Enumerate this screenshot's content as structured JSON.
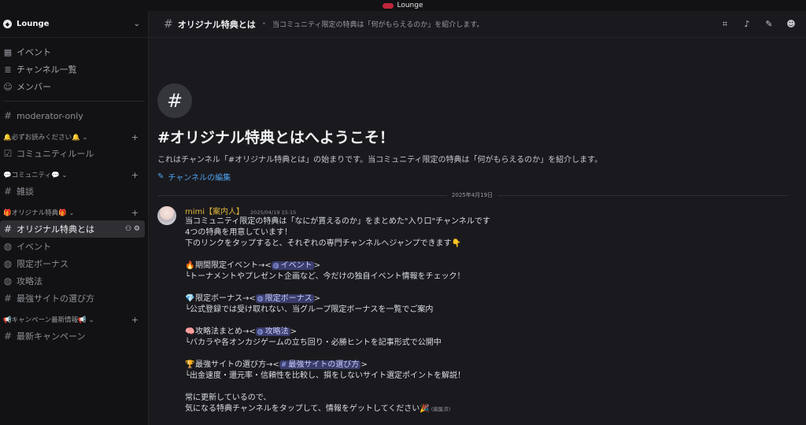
{
  "window": {
    "title": "Lounge"
  },
  "server": {
    "name": "Lounge"
  },
  "nav": [
    {
      "icon": "calendar-icon",
      "label": "イベント"
    },
    {
      "icon": "channel-list-icon",
      "label": "チャンネル一覧"
    },
    {
      "icon": "members-icon",
      "label": "メンバー"
    }
  ],
  "channels_top": [
    {
      "label": "moderator-only"
    }
  ],
  "categories": [
    {
      "label": "🔔必ずお読みください🔔",
      "channels": [
        {
          "label": "コミュニティルール",
          "icon": "rules-icon"
        }
      ]
    },
    {
      "label": "💬コミュニティ💬",
      "channels": [
        {
          "label": "雑談",
          "icon": "hash-icon"
        }
      ]
    },
    {
      "label": "🎁オリジナル特典🎁",
      "channels": [
        {
          "label": "オリジナル特典とは",
          "icon": "hash-icon",
          "active": true
        },
        {
          "label": "イベント",
          "icon": "forum-icon"
        },
        {
          "label": "限定ボーナス",
          "icon": "forum-icon"
        },
        {
          "label": "攻略法",
          "icon": "forum-icon"
        },
        {
          "label": "最強サイトの選び方",
          "icon": "hash-icon"
        }
      ]
    },
    {
      "label": "📢キャンペーン最新情報📢",
      "channels": [
        {
          "label": "最新キャンペーン",
          "icon": "hash-icon"
        }
      ]
    }
  ],
  "header": {
    "channel": "オリジナル特典とは",
    "topic": "当コミュニティ限定の特典は「何がもらえるのか」を紹介します。"
  },
  "welcome": {
    "title": "#オリジナル特典とはへようこそ！",
    "description": "これはチャンネル「#オリジナル特典とは」の始まりです。当コミュニティ限定の特典は「何がもらえるのか」を紹介します。",
    "edit_label": "チャンネルの編集"
  },
  "date_divider": "2025年4月19日",
  "message": {
    "author": "mimi【案内人】",
    "timestamp": "2025/04/19 15:15",
    "intro": [
      "当コミュニティ限定の特典は「なにが貰えるのか」をまとめた\"入り口\"チャンネルです",
      "4つの特典を用意しています！",
      "下のリンクをタップすると、それぞれの専門チャンネルへジャンプできます👇"
    ],
    "sections": [
      {
        "emoji": "🔥",
        "title": "期間限定イベント→<",
        "mention": "イベント",
        "mention_icon": "forum-icon",
        "close": ">",
        "detail": "└トーナメントやプレゼント企画など、今だけの独自イベント情報をチェック！"
      },
      {
        "emoji": "💎",
        "title": "限定ボーナス→<",
        "mention": "限定ボーナス",
        "mention_icon": "forum-icon",
        "close": ">",
        "detail": "└公式登録では受け取れない、当グループ限定ボーナスを一覧でご案内"
      },
      {
        "emoji": "🧠",
        "title": "攻略法まとめ→<",
        "mention": "攻略法",
        "mention_icon": "forum-icon",
        "close": ">",
        "detail": "└バカラや各オンカジゲームの立ち回り・必勝ヒントを記事形式で公開中"
      },
      {
        "emoji": "🏆",
        "title": "最強サイトの選び方→<",
        "mention": "最強サイトの選び方",
        "mention_icon": "hash-icon",
        "close": ">",
        "detail": "└出金速度・還元率・信頼性を比較し、損をしないサイト選定ポイントを解説！"
      }
    ],
    "outro": [
      "常に更新しているので、",
      "気になる特典チャンネルをタップして、情報をゲットしてください🎉"
    ],
    "edited_label": "(編集済)"
  }
}
